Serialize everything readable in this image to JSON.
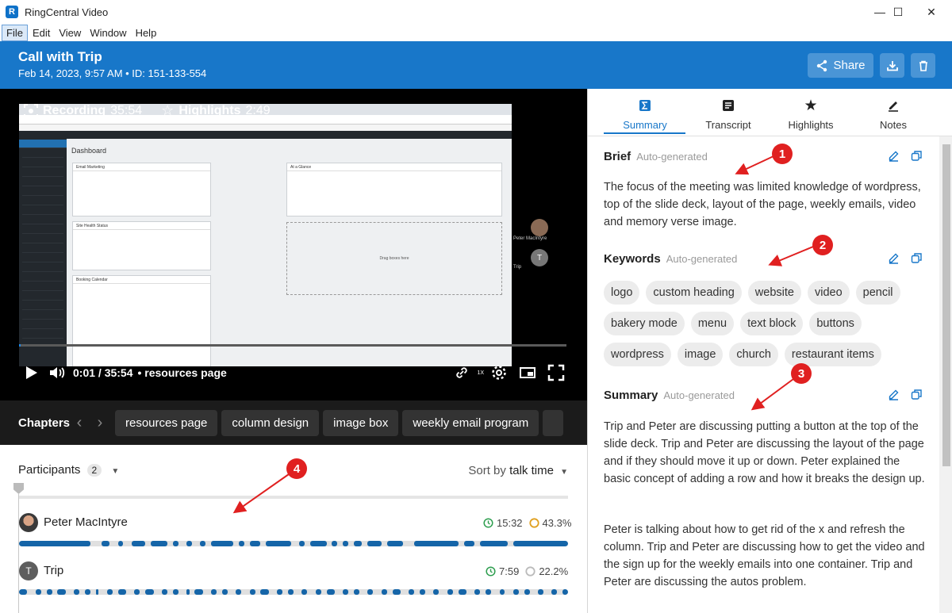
{
  "window": {
    "title": "RingCentral Video",
    "minimize": "—",
    "maximize": "☐",
    "close": "✕"
  },
  "menu": [
    "File",
    "Edit",
    "View",
    "Window",
    "Help"
  ],
  "header": {
    "title": "Call with Trip",
    "subtitle": "Feb 14, 2023, 9:57 AM • ID: 151-133-554",
    "share_label": "Share"
  },
  "video": {
    "recording_label": "Recording",
    "recording_time": "35:54",
    "highlights_label": "Highlights",
    "highlights_time": "2:49",
    "time_display": "0:01 / 35:54",
    "current_chapter": "• resources page",
    "progress_fraction": 0.0003,
    "participant_tiles": [
      "Peter MacIntyre",
      "Trip"
    ],
    "embedded_screen": {
      "page_title": "Dashboard",
      "widgets": [
        "Email Marketing",
        "At a Glance",
        "Site Health Status",
        "Booking Calendar"
      ],
      "dropzone": "Drag boxes here"
    }
  },
  "chapters": {
    "title": "Chapters",
    "items": [
      "resources page",
      "column design",
      "image box",
      "weekly email program"
    ]
  },
  "participants": {
    "title": "Participants",
    "count": "2",
    "sort_label": "Sort by",
    "sort_value": "talk time",
    "people": [
      {
        "name": "Peter MacIntyre",
        "talk_time": "15:32",
        "percent": "43.3%",
        "initial": ""
      },
      {
        "name": "Trip",
        "talk_time": "7:59",
        "percent": "22.2%",
        "initial": "T"
      }
    ]
  },
  "tabs": [
    {
      "label": "Summary",
      "icon": "sigma-icon"
    },
    {
      "label": "Transcript",
      "icon": "transcript-icon"
    },
    {
      "label": "Highlights",
      "icon": "star-icon"
    },
    {
      "label": "Notes",
      "icon": "pen-icon"
    }
  ],
  "brief": {
    "title": "Brief",
    "tag": "Auto-generated",
    "text": "The focus of the meeting was limited knowledge of wordpress, top of the slide deck, layout of the page, weekly emails, video and memory verse image."
  },
  "keywords": {
    "title": "Keywords",
    "tag": "Auto-generated",
    "items": [
      "logo",
      "custom heading",
      "website",
      "video",
      "pencil",
      "bakery mode",
      "menu",
      "text block",
      "buttons",
      "wordpress",
      "image",
      "church",
      "restaurant items"
    ]
  },
  "summary": {
    "title": "Summary",
    "tag": "Auto-generated",
    "p1": "Trip and Peter are discussing putting a button at the top of the slide deck. Trip and Peter are discussing the layout of the page and if they should move it up or down. Peter explained the basic concept of adding a row and how it breaks the design up.",
    "p2": "Peter is talking about how to get rid of the x and refresh the column. Trip and Peter are discussing how to get the video and the sign up for the weekly emails into one container. Trip and Peter are discussing the autos problem."
  },
  "annotations": [
    "1",
    "2",
    "3",
    "4"
  ],
  "colors": {
    "brand": "#1877c9",
    "annotation": "#e02020",
    "talk_bar": "#1565a8",
    "clock": "#2e9e4f",
    "percent_ring": "#e0a020"
  }
}
